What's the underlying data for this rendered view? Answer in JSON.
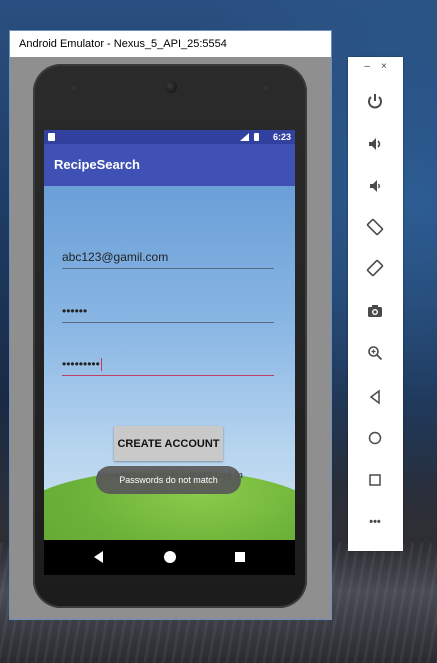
{
  "window": {
    "title": "Android Emulator - Nexus_5_API_25:5554"
  },
  "status_bar": {
    "time": "6:23"
  },
  "app": {
    "title": "RecipeSearch",
    "email_value": "abc123@gamil.com",
    "password_value": "••••••",
    "confirm_password_value": "•••••••••",
    "create_account_label": "CREATE ACCOUNT",
    "signin_text": "Already have an account? Log In",
    "toast": "Passwords do not match"
  },
  "side_controls": {
    "minimize_label": "–",
    "close_label": "×",
    "more_label": "•••",
    "buttons": [
      "power-icon",
      "volume-up-icon",
      "volume-down-icon",
      "rotate-left-icon",
      "rotate-right-icon",
      "camera-icon",
      "zoom-icon",
      "back-icon",
      "home-icon",
      "overview-icon",
      "more-icon"
    ]
  },
  "colors": {
    "app_bar": "#3f51b5",
    "status_bar": "#3240a0",
    "accent": "#c04060",
    "side_icon": "#4a4a4a"
  }
}
